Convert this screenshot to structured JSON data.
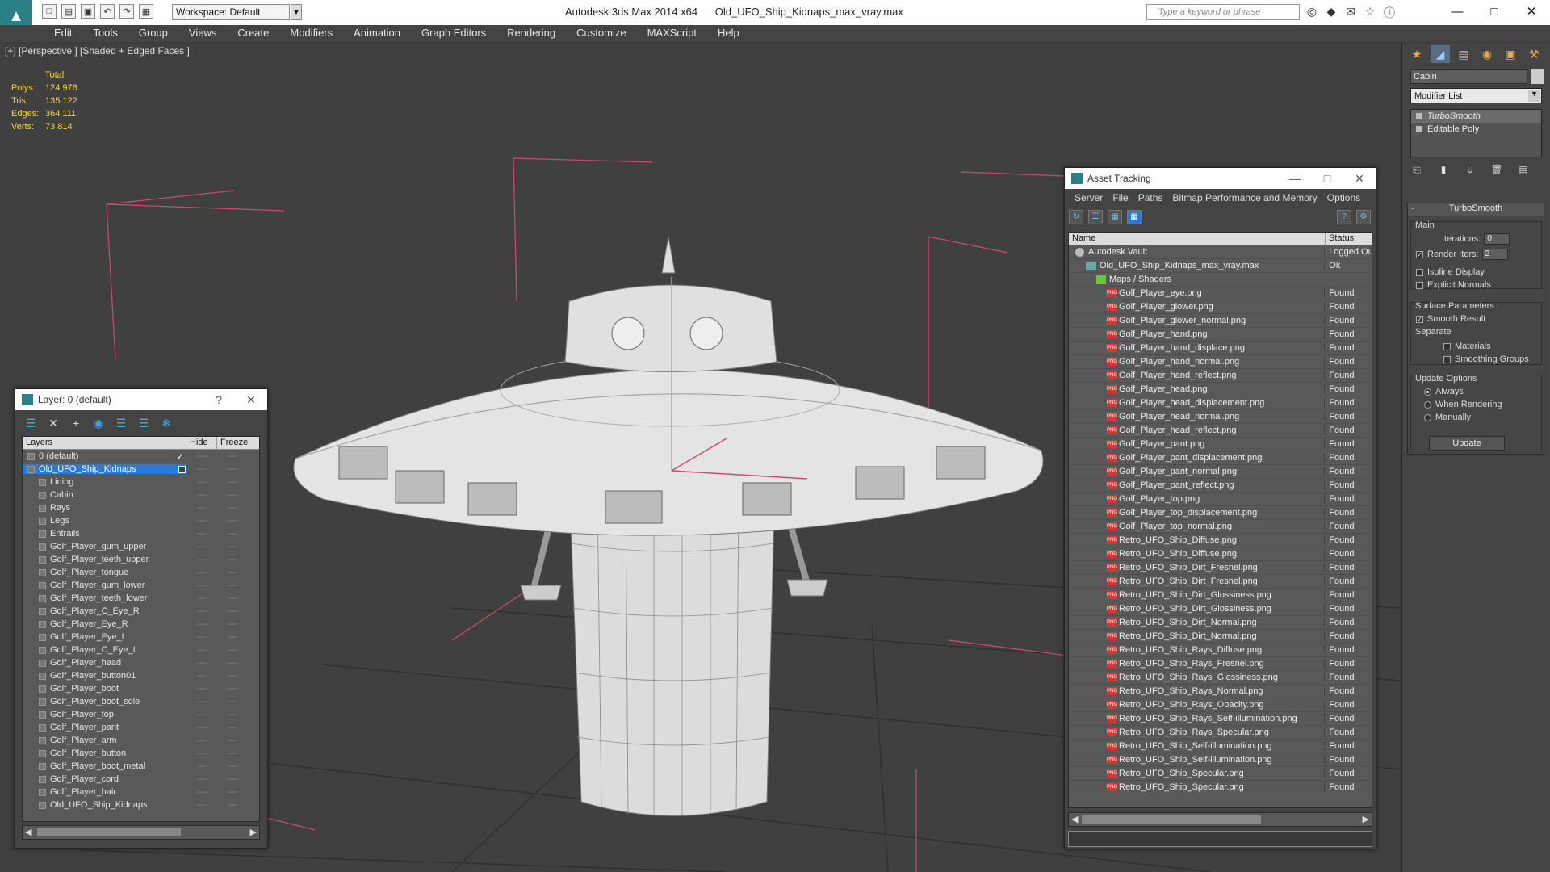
{
  "titlebar": {
    "workspace": "Workspace: Default",
    "app": "Autodesk 3ds Max 2014 x64",
    "file": "Old_UFO_Ship_Kidnaps_max_vray.max",
    "search_placeholder": "Type a keyword or phrase"
  },
  "menu": [
    "Edit",
    "Tools",
    "Group",
    "Views",
    "Create",
    "Modifiers",
    "Animation",
    "Graph Editors",
    "Rendering",
    "Customize",
    "MAXScript",
    "Help"
  ],
  "viewport": {
    "label": "[+] [Perspective ] [Shaded + Edged Faces ]",
    "stats": {
      "header": "Total",
      "rows": [
        {
          "k": "Polys:",
          "v": "124 976"
        },
        {
          "k": "Tris:",
          "v": "135 122"
        },
        {
          "k": "Edges:",
          "v": "364 111"
        },
        {
          "k": "Verts:",
          "v": "73 814"
        }
      ]
    }
  },
  "layers_panel": {
    "title": "Layer: 0 (default)",
    "help": "?",
    "col_layers": "Layers",
    "col_hide": "Hide",
    "col_freeze": "Freeze",
    "rows": [
      {
        "name": "0 (default)",
        "lvl": 1,
        "check": true
      },
      {
        "name": "Old_UFO_Ship_Kidnaps",
        "lvl": 1,
        "selected": true
      },
      {
        "name": "Lining",
        "lvl": 2
      },
      {
        "name": "Cabin",
        "lvl": 2
      },
      {
        "name": "Rays",
        "lvl": 2
      },
      {
        "name": "Legs",
        "lvl": 2
      },
      {
        "name": "Entrails",
        "lvl": 2
      },
      {
        "name": "Golf_Player_gum_upper",
        "lvl": 2
      },
      {
        "name": "Golf_Player_teeth_upper",
        "lvl": 2
      },
      {
        "name": "Golf_Player_tongue",
        "lvl": 2
      },
      {
        "name": "Golf_Player_gum_lower",
        "lvl": 2
      },
      {
        "name": "Golf_Player_teeth_lower",
        "lvl": 2
      },
      {
        "name": "Golf_Player_C_Eye_R",
        "lvl": 2
      },
      {
        "name": "Golf_Player_Eye_R",
        "lvl": 2
      },
      {
        "name": "Golf_Player_Eye_L",
        "lvl": 2
      },
      {
        "name": "Golf_Player_C_Eye_L",
        "lvl": 2
      },
      {
        "name": "Golf_Player_head",
        "lvl": 2
      },
      {
        "name": "Golf_Player_button01",
        "lvl": 2
      },
      {
        "name": "Golf_Player_boot",
        "lvl": 2
      },
      {
        "name": "Golf_Player_boot_sole",
        "lvl": 2
      },
      {
        "name": "Golf_Player_top",
        "lvl": 2
      },
      {
        "name": "Golf_Player_pant",
        "lvl": 2
      },
      {
        "name": "Golf_Player_arm",
        "lvl": 2
      },
      {
        "name": "Golf_Player_button",
        "lvl": 2
      },
      {
        "name": "Golf_Player_boot_metal",
        "lvl": 2
      },
      {
        "name": "Golf_Player_cord",
        "lvl": 2
      },
      {
        "name": "Golf_Player_hair",
        "lvl": 2
      },
      {
        "name": "Old_UFO_Ship_Kidnaps",
        "lvl": 2
      }
    ]
  },
  "asset_panel": {
    "title": "Asset Tracking",
    "menu": [
      "Server",
      "File",
      "Paths",
      "Bitmap Performance and Memory",
      "Options"
    ],
    "col_name": "Name",
    "col_status": "Status",
    "rows": [
      {
        "name": "Autodesk Vault",
        "status": "Logged Out",
        "type": "vault",
        "lvl": 0
      },
      {
        "name": "Old_UFO_Ship_Kidnaps_max_vray.max",
        "status": "Ok",
        "type": "max",
        "lvl": 1
      },
      {
        "name": "Maps / Shaders",
        "status": "",
        "type": "folder",
        "lvl": 2
      },
      {
        "name": "Golf_Player_eye.png",
        "status": "Found",
        "type": "png",
        "lvl": 3
      },
      {
        "name": "Golf_Player_glower.png",
        "status": "Found",
        "type": "png",
        "lvl": 3
      },
      {
        "name": "Golf_Player_glower_normal.png",
        "status": "Found",
        "type": "png",
        "lvl": 3
      },
      {
        "name": "Golf_Player_hand.png",
        "status": "Found",
        "type": "png",
        "lvl": 3
      },
      {
        "name": "Golf_Player_hand_displace.png",
        "status": "Found",
        "type": "png",
        "lvl": 3
      },
      {
        "name": "Golf_Player_hand_normal.png",
        "status": "Found",
        "type": "png",
        "lvl": 3
      },
      {
        "name": "Golf_Player_hand_reflect.png",
        "status": "Found",
        "type": "png",
        "lvl": 3
      },
      {
        "name": "Golf_Player_head.png",
        "status": "Found",
        "type": "png",
        "lvl": 3
      },
      {
        "name": "Golf_Player_head_displacement.png",
        "status": "Found",
        "type": "png",
        "lvl": 3
      },
      {
        "name": "Golf_Player_head_normal.png",
        "status": "Found",
        "type": "png",
        "lvl": 3
      },
      {
        "name": "Golf_Player_head_reflect.png",
        "status": "Found",
        "type": "png",
        "lvl": 3
      },
      {
        "name": "Golf_Player_pant.png",
        "status": "Found",
        "type": "png",
        "lvl": 3
      },
      {
        "name": "Golf_Player_pant_displacement.png",
        "status": "Found",
        "type": "png",
        "lvl": 3
      },
      {
        "name": "Golf_Player_pant_normal.png",
        "status": "Found",
        "type": "png",
        "lvl": 3
      },
      {
        "name": "Golf_Player_pant_reflect.png",
        "status": "Found",
        "type": "png",
        "lvl": 3
      },
      {
        "name": "Golf_Player_top.png",
        "status": "Found",
        "type": "png",
        "lvl": 3
      },
      {
        "name": "Golf_Player_top_displacement.png",
        "status": "Found",
        "type": "png",
        "lvl": 3
      },
      {
        "name": "Golf_Player_top_normal.png",
        "status": "Found",
        "type": "png",
        "lvl": 3
      },
      {
        "name": "Retro_UFO_Ship_Diffuse.png",
        "status": "Found",
        "type": "png",
        "lvl": 3
      },
      {
        "name": "Retro_UFO_Ship_Diffuse.png",
        "status": "Found",
        "type": "png",
        "lvl": 3
      },
      {
        "name": "Retro_UFO_Ship_Dirt_Fresnel.png",
        "status": "Found",
        "type": "png",
        "lvl": 3
      },
      {
        "name": "Retro_UFO_Ship_Dirt_Fresnel.png",
        "status": "Found",
        "type": "png",
        "lvl": 3
      },
      {
        "name": "Retro_UFO_Ship_Dirt_Glossiness.png",
        "status": "Found",
        "type": "png",
        "lvl": 3
      },
      {
        "name": "Retro_UFO_Ship_Dirt_Glossiness.png",
        "status": "Found",
        "type": "png",
        "lvl": 3
      },
      {
        "name": "Retro_UFO_Ship_Dirt_Normal.png",
        "status": "Found",
        "type": "png",
        "lvl": 3
      },
      {
        "name": "Retro_UFO_Ship_Dirt_Normal.png",
        "status": "Found",
        "type": "png",
        "lvl": 3
      },
      {
        "name": "Retro_UFO_Ship_Rays_Diffuse.png",
        "status": "Found",
        "type": "png",
        "lvl": 3
      },
      {
        "name": "Retro_UFO_Ship_Rays_Fresnel.png",
        "status": "Found",
        "type": "png",
        "lvl": 3
      },
      {
        "name": "Retro_UFO_Ship_Rays_Glossiness.png",
        "status": "Found",
        "type": "png",
        "lvl": 3
      },
      {
        "name": "Retro_UFO_Ship_Rays_Normal.png",
        "status": "Found",
        "type": "png",
        "lvl": 3
      },
      {
        "name": "Retro_UFO_Ship_Rays_Opacity.png",
        "status": "Found",
        "type": "png",
        "lvl": 3
      },
      {
        "name": "Retro_UFO_Ship_Rays_Self-illumination.png",
        "status": "Found",
        "type": "png",
        "lvl": 3
      },
      {
        "name": "Retro_UFO_Ship_Rays_Specular.png",
        "status": "Found",
        "type": "png",
        "lvl": 3
      },
      {
        "name": "Retro_UFO_Ship_Self-illumination.png",
        "status": "Found",
        "type": "png",
        "lvl": 3
      },
      {
        "name": "Retro_UFO_Ship_Self-illumination.png",
        "status": "Found",
        "type": "png",
        "lvl": 3
      },
      {
        "name": "Retro_UFO_Ship_Specular.png",
        "status": "Found",
        "type": "png",
        "lvl": 3
      },
      {
        "name": "Retro_UFO_Ship_Specular.png",
        "status": "Found",
        "type": "png",
        "lvl": 3
      }
    ]
  },
  "command_panel": {
    "object_name": "Cabin",
    "modifier_list": "Modifier List",
    "stack": [
      "TurboSmooth",
      "Editable Poly"
    ],
    "rollout": {
      "title": "TurboSmooth",
      "main": "Main",
      "iterations_label": "Iterations:",
      "iterations": "0",
      "render_iters_label": "Render Iters:",
      "render_iters": "2",
      "isoline": "Isoline Display",
      "explicit": "Explicit Normals",
      "surface": "Surface Parameters",
      "smooth_result": "Smooth Result",
      "separate": "Separate",
      "materials": "Materials",
      "smoothing_groups": "Smoothing Groups",
      "update_options": "Update Options",
      "always": "Always",
      "when_rendering": "When Rendering",
      "manually": "Manually",
      "update_btn": "Update"
    }
  },
  "colors": {
    "accent": "#2b7bd6",
    "stats": "#f5d63b",
    "selection": "#2b7bd6"
  }
}
